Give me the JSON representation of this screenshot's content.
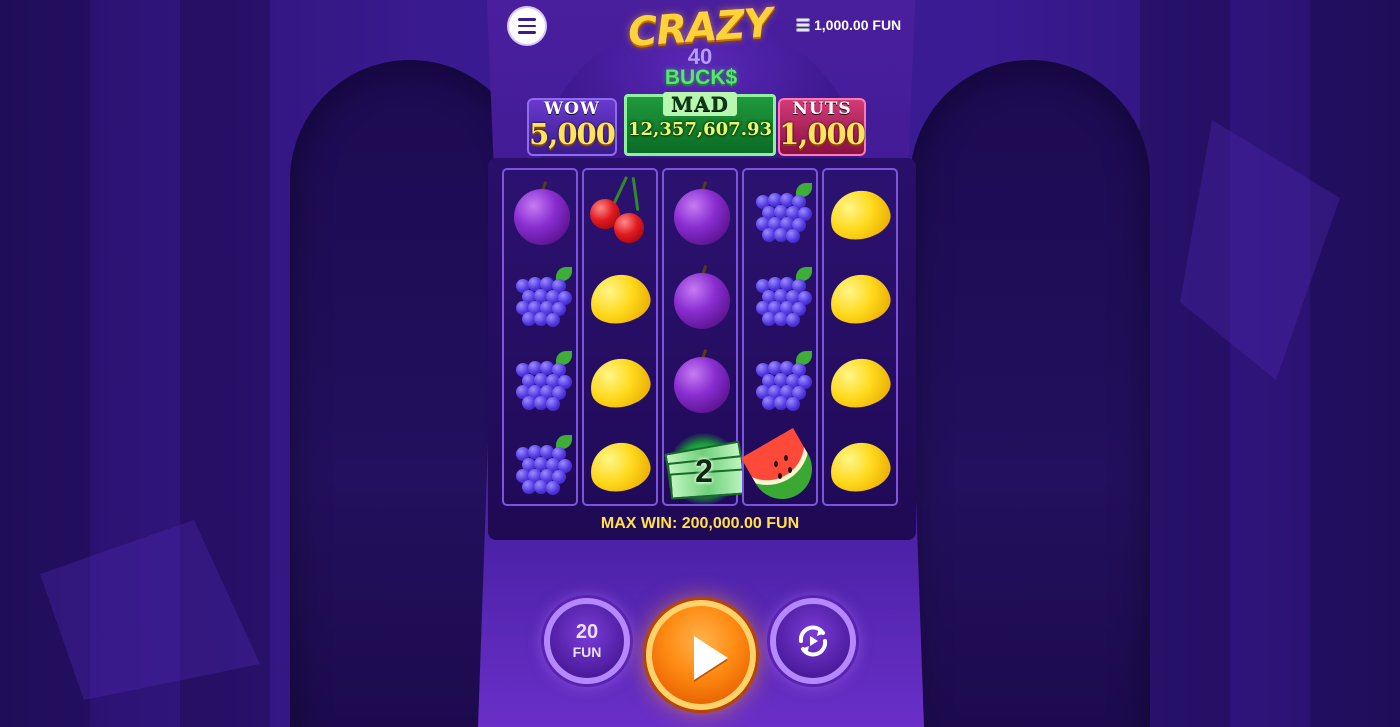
{
  "header": {
    "balance": "1,000.00 FUN"
  },
  "logo": {
    "line1": "CRAZY",
    "line2": "40",
    "line3": "BUCK$"
  },
  "jackpots": [
    {
      "label": "WOW",
      "value": "5,000"
    },
    {
      "label": "MAD",
      "value": "12,357,607.93"
    },
    {
      "label": "NUTS",
      "value": "1,000"
    }
  ],
  "reels": [
    [
      "plum",
      "grapes",
      "grapes",
      "grapes"
    ],
    [
      "cherries",
      "lemon",
      "lemon",
      "lemon"
    ],
    [
      "plum",
      "plum",
      "plum",
      "cash"
    ],
    [
      "grapes",
      "grapes",
      "grapes",
      "watermelon"
    ],
    [
      "lemon",
      "lemon",
      "lemon",
      "lemon"
    ]
  ],
  "cash_symbol_value": "2",
  "max_win": "MAX WIN: 200,000.00 FUN",
  "controls": {
    "bet_amount": "20",
    "bet_currency": "FUN",
    "spin_icon": "play-icon",
    "autoplay_icon": "autoplay-icon",
    "menu_icon": "hamburger-menu-icon"
  },
  "colors": {
    "background": "#2a1370",
    "accent_gold": "#ffe14a",
    "spin_orange": "#ff8a12",
    "button_purple": "#b688ff"
  }
}
